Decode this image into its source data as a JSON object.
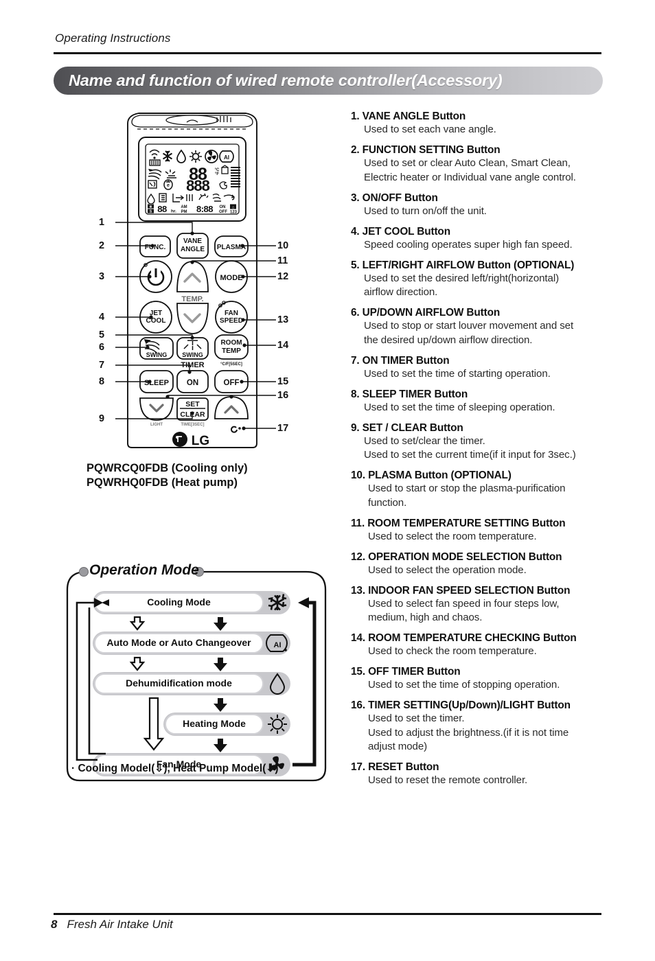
{
  "header": {
    "running_head": "Operating Instructions",
    "title": "Name and function of wired remote controller(Accessory)"
  },
  "footer": {
    "page_number": "8",
    "doc_title": "Fresh Air Intake Unit"
  },
  "remote": {
    "model_cooling": "PQWRCQ0FDB (Cooling only)",
    "model_heatpump": "PQWRHQ0FDB (Heat pump)",
    "brand": "LG",
    "buttons": {
      "func": "FUNC.",
      "vane_angle_l1": "VANE",
      "vane_angle_l2": "ANGLE",
      "plasma": "PLASMA",
      "mode": "MODE",
      "jet_l1": "JET",
      "jet_l2": "COOL",
      "temp": "TEMP.",
      "fan_l1": "FAN",
      "fan_l2": "SPEED",
      "swing_left": "SWING",
      "swing_right": "SWING",
      "room_temp_l1": "ROOM",
      "room_temp_l2": "TEMP",
      "room_temp_sub": "°C/F[5SEC]",
      "timer": "TIMER",
      "sleep": "SLEEP",
      "on": "ON",
      "off": "OFF",
      "set": "SET",
      "clear": "CLEAR",
      "light_sub": "LIGHT",
      "time_sub": "TIME[3SEC]"
    },
    "lcd": {
      "temp_digits": "88",
      "temp_digits_2": "888",
      "unit": "°C/°F",
      "timer_digits": "88",
      "hr": "hr.",
      "am": "AM",
      "pm": "PM",
      "clock_digits": "88:88",
      "on": "ON",
      "off": "OFF",
      "group_numbers": "123",
      "ai": "AI"
    },
    "callouts_left": [
      "1",
      "2",
      "3",
      "4",
      "5",
      "6",
      "7",
      "8",
      "9"
    ],
    "callouts_right": [
      "10",
      "11",
      "12",
      "13",
      "14",
      "15",
      "16",
      "17"
    ]
  },
  "operation_mode": {
    "title": "Operation Mode",
    "note": "· Cooling Model(⇩), Heat Pump Model(⬇)",
    "steps": [
      {
        "label": "Cooling Mode",
        "icon": "snowflake-icon"
      },
      {
        "label": "Auto Mode or Auto Changeover",
        "icon": "ai-icon"
      },
      {
        "label": "Dehumidification mode",
        "icon": "water-drop-icon"
      },
      {
        "label": "Heating Mode",
        "icon": "sun-icon"
      },
      {
        "label": "Fan Mode",
        "icon": "fan-icon"
      }
    ]
  },
  "functions": [
    {
      "n": "1.",
      "title": "VANE ANGLE Button",
      "lines": [
        "Used to set each vane angle."
      ]
    },
    {
      "n": "2.",
      "title": "FUNCTION SETTING Button",
      "lines": [
        "Used to set or clear Auto Clean, Smart Clean,",
        "Electric heater or Individual vane angle control."
      ]
    },
    {
      "n": "3.",
      "title": "ON/OFF Button",
      "lines": [
        "Used to turn on/off the unit."
      ]
    },
    {
      "n": "4.",
      "title": "JET COOL Button",
      "lines": [
        "Speed cooling operates super high fan speed."
      ]
    },
    {
      "n": "5.",
      "title": "LEFT/RIGHT AIRFLOW Button (OPTIONAL)",
      "lines": [
        "Used to set the desired left/right(horizontal)",
        "airflow direction."
      ]
    },
    {
      "n": "6.",
      "title": "UP/DOWN AIRFLOW Button",
      "lines": [
        "Used to stop or start louver movement and set",
        "the desired up/down airflow direction."
      ]
    },
    {
      "n": "7.",
      "title": "ON TIMER Button",
      "lines": [
        "Used to set the time of starting operation."
      ]
    },
    {
      "n": "8.",
      "title": "SLEEP TIMER Button",
      "lines": [
        "Used to set the time of sleeping operation."
      ]
    },
    {
      "n": "9.",
      "title": "SET / CLEAR Button",
      "lines": [
        "Used to set/clear the timer.",
        "Used to set the current time(if it input for 3sec.)"
      ]
    },
    {
      "n": "10.",
      "title": "PLASMA Button (OPTIONAL)",
      "lines": [
        "Used to start or stop the plasma-purification",
        "function."
      ]
    },
    {
      "n": "11.",
      "title": "ROOM TEMPERATURE SETTING Button",
      "lines": [
        "Used to select the room temperature."
      ]
    },
    {
      "n": "12.",
      "title": "OPERATION MODE SELECTION Button",
      "lines": [
        "Used to select the operation mode."
      ]
    },
    {
      "n": "13.",
      "title": "INDOOR FAN SPEED SELECTION Button",
      "lines": [
        "Used to select fan speed in four steps low,",
        "medium, high and chaos."
      ]
    },
    {
      "n": "14.",
      "title": "ROOM TEMPERATURE CHECKING Button",
      "lines": [
        "Used to check the room temperature."
      ]
    },
    {
      "n": "15.",
      "title": "OFF TIMER Button",
      "lines": [
        "Used to set the time of stopping operation."
      ]
    },
    {
      "n": "16.",
      "title": "TIMER SETTING(Up/Down)/LIGHT Button",
      "lines": [
        "Used to set the timer.",
        "Used to adjust the brightness.(if it is not time",
        "adjust mode)"
      ]
    },
    {
      "n": "17.",
      "title": "RESET Button",
      "lines": [
        "Used to reset the remote controller."
      ]
    }
  ],
  "colors": {
    "ink": "#111111",
    "title_gradient_start": "#4e4e52",
    "title_gradient_end": "#cfcfd3",
    "pill_fill": "#c8c8cc",
    "pill_inner": "#ffffff"
  }
}
